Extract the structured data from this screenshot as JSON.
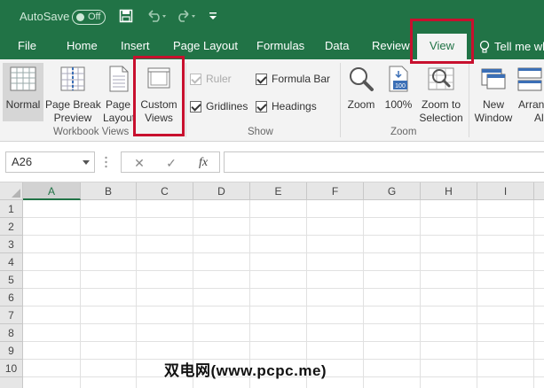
{
  "titlebar": {
    "autosave_label": "AutoSave",
    "autosave_state": "Off",
    "icons": [
      "save-icon",
      "undo-icon",
      "redo-icon",
      "customize-qat-icon"
    ]
  },
  "tabs": [
    {
      "label": "File"
    },
    {
      "label": "Home"
    },
    {
      "label": "Insert"
    },
    {
      "label": "Page Layout"
    },
    {
      "label": "Formulas"
    },
    {
      "label": "Data"
    },
    {
      "label": "Review"
    },
    {
      "label": "View",
      "active": true
    },
    {
      "label": "Tell me wh"
    }
  ],
  "ribbon": {
    "workbook_views": {
      "label": "Workbook Views",
      "normal": "Normal",
      "page_break_1": "Page Break",
      "page_break_2": "Preview",
      "page_layout_1": "Page",
      "page_layout_2": "Layout",
      "custom_1": "Custom",
      "custom_2": "Views"
    },
    "show": {
      "label": "Show",
      "ruler": "Ruler",
      "formula_bar": "Formula Bar",
      "gridlines": "Gridlines",
      "headings": "Headings",
      "ruler_checked": true,
      "ruler_disabled": true,
      "formula_bar_checked": true,
      "gridlines_checked": true,
      "headings_checked": true
    },
    "zoom": {
      "label": "Zoom",
      "zoom": "Zoom",
      "hundred": "100%",
      "hundred_icon_text": "100",
      "zoom_sel_1": "Zoom to",
      "zoom_sel_2": "Selection"
    },
    "window": {
      "new_1": "New",
      "new_2": "Window",
      "arrange_1": "Arrange",
      "arrange_2": "All"
    }
  },
  "formula_bar": {
    "name_box": "A26",
    "cancel": "✕",
    "enter": "✓",
    "fx": "fx",
    "formula_value": ""
  },
  "grid": {
    "columns": [
      "A",
      "B",
      "C",
      "D",
      "E",
      "F",
      "G",
      "H",
      "I"
    ],
    "rows": [
      "1",
      "2",
      "3",
      "4",
      "5",
      "6",
      "7",
      "8",
      "9",
      "10"
    ],
    "active_column": "A"
  },
  "watermark": "双电网(www.pcpc.me)",
  "colors": {
    "brand_green": "#217346",
    "highlight_red": "#c8102e",
    "ribbon_bg": "#f3f3f3",
    "header_bg": "#e6e6e6"
  }
}
